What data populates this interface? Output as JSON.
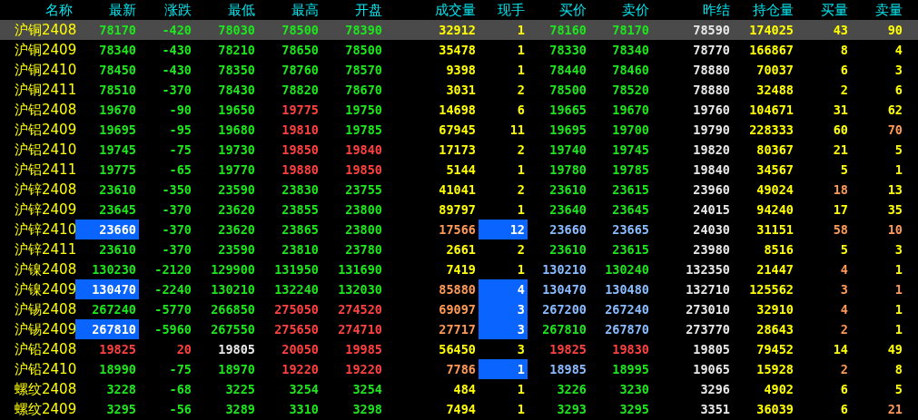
{
  "columns": [
    "名称",
    "最新",
    "涨跌",
    "最低",
    "最高",
    "开盘",
    "成交量",
    "现手",
    "买价",
    "卖价",
    "昨结",
    "持仓量",
    "买量",
    "卖量"
  ],
  "rows": [
    {
      "selected": true,
      "cells": [
        {
          "text": "沪铜2408",
          "color": "#ffff00"
        },
        {
          "text": "78170",
          "color": "#1ee61e"
        },
        {
          "text": "-420",
          "color": "#1ee61e"
        },
        {
          "text": "78030",
          "color": "#1ee61e"
        },
        {
          "text": "78500",
          "color": "#1ee61e"
        },
        {
          "text": "78390",
          "color": "#1ee61e"
        },
        {
          "text": "32912",
          "color": "#ffff00"
        },
        {
          "text": "1",
          "color": "#ffff00"
        },
        {
          "text": "78160",
          "color": "#1ee61e"
        },
        {
          "text": "78170",
          "color": "#1ee61e"
        },
        {
          "text": "78590",
          "color": "#e8e8e8"
        },
        {
          "text": "174025",
          "color": "#ffff00"
        },
        {
          "text": "43",
          "color": "#ffff00"
        },
        {
          "text": "90",
          "color": "#ffff00"
        }
      ]
    },
    {
      "selected": false,
      "cells": [
        {
          "text": "沪铜2409",
          "color": "#ffff00"
        },
        {
          "text": "78340",
          "color": "#1ee61e"
        },
        {
          "text": "-430",
          "color": "#1ee61e"
        },
        {
          "text": "78210",
          "color": "#1ee61e"
        },
        {
          "text": "78650",
          "color": "#1ee61e"
        },
        {
          "text": "78500",
          "color": "#1ee61e"
        },
        {
          "text": "35478",
          "color": "#ffff00"
        },
        {
          "text": "1",
          "color": "#ffff00"
        },
        {
          "text": "78330",
          "color": "#1ee61e"
        },
        {
          "text": "78340",
          "color": "#1ee61e"
        },
        {
          "text": "78770",
          "color": "#e8e8e8"
        },
        {
          "text": "166867",
          "color": "#ffff00"
        },
        {
          "text": "8",
          "color": "#ffff00"
        },
        {
          "text": "4",
          "color": "#ffff00"
        }
      ]
    },
    {
      "selected": false,
      "cells": [
        {
          "text": "沪铜2410",
          "color": "#ffff00"
        },
        {
          "text": "78450",
          "color": "#1ee61e"
        },
        {
          "text": "-430",
          "color": "#1ee61e"
        },
        {
          "text": "78350",
          "color": "#1ee61e"
        },
        {
          "text": "78760",
          "color": "#1ee61e"
        },
        {
          "text": "78570",
          "color": "#1ee61e"
        },
        {
          "text": "9398",
          "color": "#ffff00"
        },
        {
          "text": "1",
          "color": "#ffff00"
        },
        {
          "text": "78440",
          "color": "#1ee61e"
        },
        {
          "text": "78460",
          "color": "#1ee61e"
        },
        {
          "text": "78880",
          "color": "#e8e8e8"
        },
        {
          "text": "70037",
          "color": "#ffff00"
        },
        {
          "text": "6",
          "color": "#ffff00"
        },
        {
          "text": "3",
          "color": "#ffff00"
        }
      ]
    },
    {
      "selected": false,
      "cells": [
        {
          "text": "沪铜2411",
          "color": "#ffff00"
        },
        {
          "text": "78510",
          "color": "#1ee61e"
        },
        {
          "text": "-370",
          "color": "#1ee61e"
        },
        {
          "text": "78430",
          "color": "#1ee61e"
        },
        {
          "text": "78820",
          "color": "#1ee61e"
        },
        {
          "text": "78670",
          "color": "#1ee61e"
        },
        {
          "text": "3031",
          "color": "#ffff00"
        },
        {
          "text": "2",
          "color": "#ffff00"
        },
        {
          "text": "78500",
          "color": "#1ee61e"
        },
        {
          "text": "78520",
          "color": "#1ee61e"
        },
        {
          "text": "78880",
          "color": "#e8e8e8"
        },
        {
          "text": "32488",
          "color": "#ffff00"
        },
        {
          "text": "2",
          "color": "#ffff00"
        },
        {
          "text": "6",
          "color": "#ffff00"
        }
      ]
    },
    {
      "selected": false,
      "cells": [
        {
          "text": "沪铝2408",
          "color": "#ffff00"
        },
        {
          "text": "19670",
          "color": "#1ee61e"
        },
        {
          "text": "-90",
          "color": "#1ee61e"
        },
        {
          "text": "19650",
          "color": "#1ee61e"
        },
        {
          "text": "19775",
          "color": "#ff4040"
        },
        {
          "text": "19750",
          "color": "#1ee61e"
        },
        {
          "text": "14698",
          "color": "#ffff00"
        },
        {
          "text": "6",
          "color": "#ffff00"
        },
        {
          "text": "19665",
          "color": "#1ee61e"
        },
        {
          "text": "19670",
          "color": "#1ee61e"
        },
        {
          "text": "19760",
          "color": "#e8e8e8"
        },
        {
          "text": "104671",
          "color": "#ffff00"
        },
        {
          "text": "31",
          "color": "#ffff00"
        },
        {
          "text": "62",
          "color": "#ffff00"
        }
      ]
    },
    {
      "selected": false,
      "cells": [
        {
          "text": "沪铝2409",
          "color": "#ffff00"
        },
        {
          "text": "19695",
          "color": "#1ee61e"
        },
        {
          "text": "-95",
          "color": "#1ee61e"
        },
        {
          "text": "19680",
          "color": "#1ee61e"
        },
        {
          "text": "19810",
          "color": "#ff4040"
        },
        {
          "text": "19785",
          "color": "#1ee61e"
        },
        {
          "text": "67945",
          "color": "#ffff00"
        },
        {
          "text": "11",
          "color": "#ffff00"
        },
        {
          "text": "19695",
          "color": "#1ee61e"
        },
        {
          "text": "19700",
          "color": "#1ee61e"
        },
        {
          "text": "19790",
          "color": "#e8e8e8"
        },
        {
          "text": "228333",
          "color": "#ffff00"
        },
        {
          "text": "60",
          "color": "#ffff00"
        },
        {
          "text": "70",
          "color": "#ff9955"
        }
      ]
    },
    {
      "selected": false,
      "cells": [
        {
          "text": "沪铝2410",
          "color": "#ffff00"
        },
        {
          "text": "19745",
          "color": "#1ee61e"
        },
        {
          "text": "-75",
          "color": "#1ee61e"
        },
        {
          "text": "19730",
          "color": "#1ee61e"
        },
        {
          "text": "19850",
          "color": "#ff4040"
        },
        {
          "text": "19840",
          "color": "#ff4040"
        },
        {
          "text": "17173",
          "color": "#ffff00"
        },
        {
          "text": "2",
          "color": "#ffff00"
        },
        {
          "text": "19740",
          "color": "#1ee61e"
        },
        {
          "text": "19745",
          "color": "#1ee61e"
        },
        {
          "text": "19820",
          "color": "#e8e8e8"
        },
        {
          "text": "80367",
          "color": "#ffff00"
        },
        {
          "text": "21",
          "color": "#ffff00"
        },
        {
          "text": "5",
          "color": "#ffff00"
        }
      ]
    },
    {
      "selected": false,
      "cells": [
        {
          "text": "沪铝2411",
          "color": "#ffff00"
        },
        {
          "text": "19775",
          "color": "#1ee61e"
        },
        {
          "text": "-65",
          "color": "#1ee61e"
        },
        {
          "text": "19770",
          "color": "#1ee61e"
        },
        {
          "text": "19880",
          "color": "#ff4040"
        },
        {
          "text": "19850",
          "color": "#ff4040"
        },
        {
          "text": "5144",
          "color": "#ffff00"
        },
        {
          "text": "1",
          "color": "#ffff00"
        },
        {
          "text": "19780",
          "color": "#1ee61e"
        },
        {
          "text": "19785",
          "color": "#1ee61e"
        },
        {
          "text": "19840",
          "color": "#e8e8e8"
        },
        {
          "text": "34567",
          "color": "#ffff00"
        },
        {
          "text": "5",
          "color": "#ffff00"
        },
        {
          "text": "1",
          "color": "#ffff00"
        }
      ]
    },
    {
      "selected": false,
      "cells": [
        {
          "text": "沪锌2408",
          "color": "#ffff00"
        },
        {
          "text": "23610",
          "color": "#1ee61e"
        },
        {
          "text": "-350",
          "color": "#1ee61e"
        },
        {
          "text": "23590",
          "color": "#1ee61e"
        },
        {
          "text": "23830",
          "color": "#1ee61e"
        },
        {
          "text": "23755",
          "color": "#1ee61e"
        },
        {
          "text": "41041",
          "color": "#ffff00"
        },
        {
          "text": "2",
          "color": "#ffff00"
        },
        {
          "text": "23610",
          "color": "#1ee61e"
        },
        {
          "text": "23615",
          "color": "#1ee61e"
        },
        {
          "text": "23960",
          "color": "#e8e8e8"
        },
        {
          "text": "49024",
          "color": "#ffff00"
        },
        {
          "text": "18",
          "color": "#ff9955"
        },
        {
          "text": "13",
          "color": "#ffff00"
        }
      ]
    },
    {
      "selected": false,
      "cells": [
        {
          "text": "沪锌2409",
          "color": "#ffff00"
        },
        {
          "text": "23645",
          "color": "#1ee61e"
        },
        {
          "text": "-370",
          "color": "#1ee61e"
        },
        {
          "text": "23620",
          "color": "#1ee61e"
        },
        {
          "text": "23855",
          "color": "#1ee61e"
        },
        {
          "text": "23800",
          "color": "#1ee61e"
        },
        {
          "text": "89797",
          "color": "#ffff00"
        },
        {
          "text": "1",
          "color": "#ffff00"
        },
        {
          "text": "23640",
          "color": "#1ee61e"
        },
        {
          "text": "23645",
          "color": "#1ee61e"
        },
        {
          "text": "24015",
          "color": "#e8e8e8"
        },
        {
          "text": "94240",
          "color": "#ffff00"
        },
        {
          "text": "17",
          "color": "#ffff00"
        },
        {
          "text": "35",
          "color": "#ffff00"
        }
      ]
    },
    {
      "selected": false,
      "cells": [
        {
          "text": "沪锌2410",
          "color": "#ffff00"
        },
        {
          "text": "23660",
          "color": "#ffffff",
          "flash": true
        },
        {
          "text": "-370",
          "color": "#1ee61e"
        },
        {
          "text": "23620",
          "color": "#1ee61e"
        },
        {
          "text": "23865",
          "color": "#1ee61e"
        },
        {
          "text": "23800",
          "color": "#1ee61e"
        },
        {
          "text": "17566",
          "color": "#ff9955"
        },
        {
          "text": "12",
          "color": "#ffffff",
          "flash": true
        },
        {
          "text": "23660",
          "color": "#88bbff"
        },
        {
          "text": "23665",
          "color": "#88bbff"
        },
        {
          "text": "24030",
          "color": "#e8e8e8"
        },
        {
          "text": "31151",
          "color": "#ffff00"
        },
        {
          "text": "58",
          "color": "#ff9955"
        },
        {
          "text": "10",
          "color": "#ff9955"
        }
      ]
    },
    {
      "selected": false,
      "cells": [
        {
          "text": "沪锌2411",
          "color": "#ffff00"
        },
        {
          "text": "23610",
          "color": "#1ee61e"
        },
        {
          "text": "-370",
          "color": "#1ee61e"
        },
        {
          "text": "23590",
          "color": "#1ee61e"
        },
        {
          "text": "23810",
          "color": "#1ee61e"
        },
        {
          "text": "23780",
          "color": "#1ee61e"
        },
        {
          "text": "2661",
          "color": "#ffff00"
        },
        {
          "text": "2",
          "color": "#ffff00"
        },
        {
          "text": "23610",
          "color": "#1ee61e"
        },
        {
          "text": "23615",
          "color": "#1ee61e"
        },
        {
          "text": "23980",
          "color": "#e8e8e8"
        },
        {
          "text": "8516",
          "color": "#ffff00"
        },
        {
          "text": "5",
          "color": "#ffff00"
        },
        {
          "text": "3",
          "color": "#ffff00"
        }
      ]
    },
    {
      "selected": false,
      "cells": [
        {
          "text": "沪镍2408",
          "color": "#ffff00"
        },
        {
          "text": "130230",
          "color": "#1ee61e"
        },
        {
          "text": "-2120",
          "color": "#1ee61e"
        },
        {
          "text": "129900",
          "color": "#1ee61e"
        },
        {
          "text": "131950",
          "color": "#1ee61e"
        },
        {
          "text": "131690",
          "color": "#1ee61e"
        },
        {
          "text": "7419",
          "color": "#ffff00"
        },
        {
          "text": "1",
          "color": "#ffff00"
        },
        {
          "text": "130210",
          "color": "#88bbff"
        },
        {
          "text": "130240",
          "color": "#1ee61e"
        },
        {
          "text": "132350",
          "color": "#e8e8e8"
        },
        {
          "text": "21447",
          "color": "#ffff00"
        },
        {
          "text": "4",
          "color": "#ff9955"
        },
        {
          "text": "1",
          "color": "#ffff00"
        }
      ]
    },
    {
      "selected": false,
      "cells": [
        {
          "text": "沪镍2409",
          "color": "#ffff00"
        },
        {
          "text": "130470",
          "color": "#ffffff",
          "flash": true
        },
        {
          "text": "-2240",
          "color": "#1ee61e"
        },
        {
          "text": "130210",
          "color": "#1ee61e"
        },
        {
          "text": "132240",
          "color": "#1ee61e"
        },
        {
          "text": "132030",
          "color": "#1ee61e"
        },
        {
          "text": "85880",
          "color": "#ff9955"
        },
        {
          "text": "4",
          "color": "#ffffff",
          "flash": true
        },
        {
          "text": "130470",
          "color": "#88bbff"
        },
        {
          "text": "130480",
          "color": "#88bbff"
        },
        {
          "text": "132710",
          "color": "#e8e8e8"
        },
        {
          "text": "125562",
          "color": "#ffff00"
        },
        {
          "text": "3",
          "color": "#ff9955"
        },
        {
          "text": "1",
          "color": "#ff9955"
        }
      ]
    },
    {
      "selected": false,
      "cells": [
        {
          "text": "沪锡2408",
          "color": "#ffff00"
        },
        {
          "text": "267240",
          "color": "#1ee61e"
        },
        {
          "text": "-5770",
          "color": "#1ee61e"
        },
        {
          "text": "266850",
          "color": "#1ee61e"
        },
        {
          "text": "275050",
          "color": "#ff4040"
        },
        {
          "text": "274520",
          "color": "#ff4040"
        },
        {
          "text": "69097",
          "color": "#ff9955"
        },
        {
          "text": "3",
          "color": "#ffffff",
          "flash": true
        },
        {
          "text": "267200",
          "color": "#88bbff"
        },
        {
          "text": "267240",
          "color": "#88bbff"
        },
        {
          "text": "273010",
          "color": "#e8e8e8"
        },
        {
          "text": "32910",
          "color": "#ffff00"
        },
        {
          "text": "4",
          "color": "#ff9955"
        },
        {
          "text": "1",
          "color": "#ffff00"
        }
      ]
    },
    {
      "selected": false,
      "cells": [
        {
          "text": "沪锡2409",
          "color": "#ffff00"
        },
        {
          "text": "267810",
          "color": "#ffffff",
          "flash": true
        },
        {
          "text": "-5960",
          "color": "#1ee61e"
        },
        {
          "text": "267550",
          "color": "#1ee61e"
        },
        {
          "text": "275650",
          "color": "#ff4040"
        },
        {
          "text": "274710",
          "color": "#ff4040"
        },
        {
          "text": "27717",
          "color": "#ff9955"
        },
        {
          "text": "3",
          "color": "#ffffff",
          "flash": true
        },
        {
          "text": "267810",
          "color": "#1ee61e"
        },
        {
          "text": "267870",
          "color": "#88bbff"
        },
        {
          "text": "273770",
          "color": "#e8e8e8"
        },
        {
          "text": "28643",
          "color": "#ffff00"
        },
        {
          "text": "2",
          "color": "#ff9955"
        },
        {
          "text": "1",
          "color": "#ffff00"
        }
      ]
    },
    {
      "selected": false,
      "cells": [
        {
          "text": "沪铅2408",
          "color": "#ffff00"
        },
        {
          "text": "19825",
          "color": "#ff4040"
        },
        {
          "text": "20",
          "color": "#ff4040"
        },
        {
          "text": "19805",
          "color": "#e8e8e8"
        },
        {
          "text": "20050",
          "color": "#ff4040"
        },
        {
          "text": "19985",
          "color": "#ff4040"
        },
        {
          "text": "56450",
          "color": "#ffff00"
        },
        {
          "text": "3",
          "color": "#ffff00"
        },
        {
          "text": "19825",
          "color": "#ff4040"
        },
        {
          "text": "19830",
          "color": "#ff4040"
        },
        {
          "text": "19805",
          "color": "#e8e8e8"
        },
        {
          "text": "79452",
          "color": "#ffff00"
        },
        {
          "text": "14",
          "color": "#ffff00"
        },
        {
          "text": "49",
          "color": "#ffff00"
        }
      ]
    },
    {
      "selected": false,
      "cells": [
        {
          "text": "沪铅2410",
          "color": "#ffff00"
        },
        {
          "text": "18990",
          "color": "#1ee61e"
        },
        {
          "text": "-75",
          "color": "#1ee61e"
        },
        {
          "text": "18970",
          "color": "#1ee61e"
        },
        {
          "text": "19220",
          "color": "#ff4040"
        },
        {
          "text": "19220",
          "color": "#ff4040"
        },
        {
          "text": "7786",
          "color": "#ff9955"
        },
        {
          "text": "1",
          "color": "#ffffff",
          "flash": true
        },
        {
          "text": "18985",
          "color": "#88bbff"
        },
        {
          "text": "18995",
          "color": "#1ee61e"
        },
        {
          "text": "19065",
          "color": "#e8e8e8"
        },
        {
          "text": "15928",
          "color": "#ffff00"
        },
        {
          "text": "2",
          "color": "#ff9955"
        },
        {
          "text": "8",
          "color": "#ffff00"
        }
      ]
    },
    {
      "selected": false,
      "cells": [
        {
          "text": "螺纹2408",
          "color": "#ffff00"
        },
        {
          "text": "3228",
          "color": "#1ee61e"
        },
        {
          "text": "-68",
          "color": "#1ee61e"
        },
        {
          "text": "3225",
          "color": "#1ee61e"
        },
        {
          "text": "3254",
          "color": "#1ee61e"
        },
        {
          "text": "3254",
          "color": "#1ee61e"
        },
        {
          "text": "484",
          "color": "#ffff00"
        },
        {
          "text": "1",
          "color": "#ffff00"
        },
        {
          "text": "3226",
          "color": "#1ee61e"
        },
        {
          "text": "3230",
          "color": "#1ee61e"
        },
        {
          "text": "3296",
          "color": "#e8e8e8"
        },
        {
          "text": "4902",
          "color": "#ffff00"
        },
        {
          "text": "6",
          "color": "#ffff00"
        },
        {
          "text": "5",
          "color": "#ffff00"
        }
      ]
    },
    {
      "selected": false,
      "cells": [
        {
          "text": "螺纹2409",
          "color": "#ffff00"
        },
        {
          "text": "3295",
          "color": "#1ee61e"
        },
        {
          "text": "-56",
          "color": "#1ee61e"
        },
        {
          "text": "3289",
          "color": "#1ee61e"
        },
        {
          "text": "3310",
          "color": "#1ee61e"
        },
        {
          "text": "3298",
          "color": "#1ee61e"
        },
        {
          "text": "7494",
          "color": "#ffff00"
        },
        {
          "text": "1",
          "color": "#ffff00"
        },
        {
          "text": "3293",
          "color": "#1ee61e"
        },
        {
          "text": "3295",
          "color": "#1ee61e"
        },
        {
          "text": "3351",
          "color": "#e8e8e8"
        },
        {
          "text": "36039",
          "color": "#ffff00"
        },
        {
          "text": "6",
          "color": "#ffff00"
        },
        {
          "text": "21",
          "color": "#ff9955"
        }
      ]
    }
  ]
}
